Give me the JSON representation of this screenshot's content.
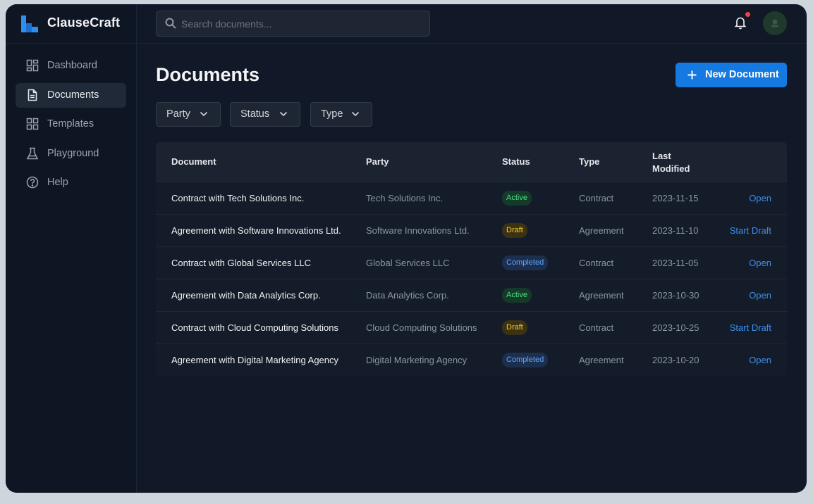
{
  "app": {
    "name": "ClauseCraft"
  },
  "sidebar": {
    "items": [
      {
        "label": "Dashboard",
        "icon": "dashboard-grid-icon",
        "active": false
      },
      {
        "label": "Documents",
        "icon": "document-icon",
        "active": true
      },
      {
        "label": "Templates",
        "icon": "templates-grid-icon",
        "active": false
      },
      {
        "label": "Playground",
        "icon": "flask-icon",
        "active": false
      },
      {
        "label": "Help",
        "icon": "help-circle-icon",
        "active": false
      }
    ]
  },
  "header": {
    "search_placeholder": "Search documents...",
    "notification_icon": "bell-icon",
    "has_unread": true
  },
  "main": {
    "title": "Documents",
    "new_button_label": "New Document",
    "filters": [
      {
        "label": "Party"
      },
      {
        "label": "Status"
      },
      {
        "label": "Type"
      }
    ]
  },
  "table": {
    "columns": [
      "Document",
      "Party",
      "Status",
      "Type",
      "Last Modified"
    ],
    "column_last_lines": [
      "Last",
      "Modified"
    ],
    "rows": [
      {
        "document": "Contract with Tech Solutions Inc.",
        "party": "Tech Solutions Inc.",
        "status": "Active",
        "type": "Contract",
        "modified": "2023-11-15",
        "action": "Open"
      },
      {
        "document": "Agreement with Software Innovations Ltd.",
        "party": "Software Innovations Ltd.",
        "status": "Draft",
        "type": "Agreement",
        "modified": "2023-11-10",
        "action": "Start Draft"
      },
      {
        "document": "Contract with Global Services LLC",
        "party": "Global Services LLC",
        "status": "Completed",
        "type": "Contract",
        "modified": "2023-11-05",
        "action": "Open"
      },
      {
        "document": "Agreement with Data Analytics Corp.",
        "party": "Data Analytics Corp.",
        "status": "Active",
        "type": "Agreement",
        "modified": "2023-10-30",
        "action": "Open"
      },
      {
        "document": "Contract with Cloud Computing Solutions",
        "party": "Cloud Computing Solutions",
        "status": "Draft",
        "type": "Contract",
        "modified": "2023-10-25",
        "action": "Start Draft"
      },
      {
        "document": "Agreement with Digital Marketing Agency",
        "party": "Digital Marketing Agency",
        "status": "Completed",
        "type": "Agreement",
        "modified": "2023-10-20",
        "action": "Open"
      }
    ]
  },
  "colors": {
    "accent": "#1479e0",
    "background": "#111827",
    "sidebar": "#0f1623",
    "status_active": "#4ade80",
    "status_draft": "#facc15",
    "status_completed": "#60a5fa",
    "link": "#3b8ff0"
  }
}
